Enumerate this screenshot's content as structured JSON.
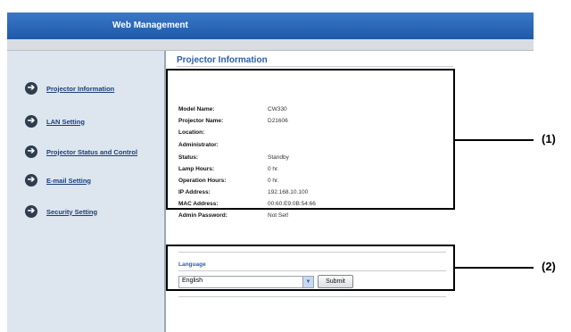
{
  "header": {
    "title": "Web Management"
  },
  "sidebar": {
    "items": [
      {
        "label": "Projector Information"
      },
      {
        "label": "LAN Setting"
      },
      {
        "label": "Projector Status and Control"
      },
      {
        "label": "E-mail Setting"
      },
      {
        "label": "Security Setting"
      }
    ]
  },
  "main": {
    "title": "Projector Information",
    "info": [
      {
        "label": "Model Name:",
        "value": "CW330"
      },
      {
        "label": "Projector Name:",
        "value": "D21606"
      },
      {
        "label": "Location:",
        "value": ""
      },
      {
        "label": "Administrator:",
        "value": ""
      },
      {
        "label": "Status:",
        "value": "Standby"
      },
      {
        "label": "Lamp Hours:",
        "value": "0 hr."
      },
      {
        "label": "Operation Hours:",
        "value": "0 hr."
      },
      {
        "label": "IP Address:",
        "value": "192.168.10.100"
      },
      {
        "label": "MAC Address:",
        "value": "00:60:E9:0B:54:66"
      },
      {
        "label": "Admin Password:",
        "value": "Not Set!"
      }
    ]
  },
  "language": {
    "label": "Language",
    "selected": "English",
    "submit_label": "Submit"
  },
  "callouts": {
    "one": "(1)",
    "two": "(2)"
  }
}
